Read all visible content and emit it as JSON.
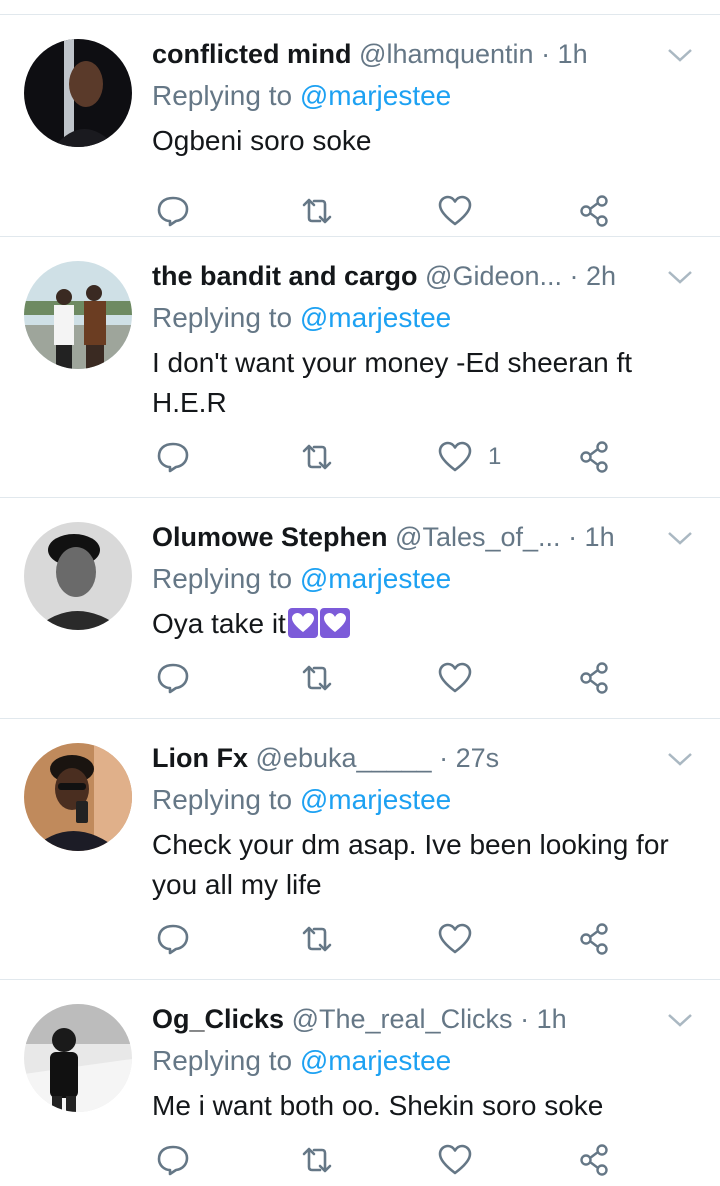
{
  "replying_label": "Replying to",
  "tweets": [
    {
      "name": "conflicted mind",
      "handle": "@lhamquentin",
      "time": "· 1h",
      "mention": "@marjestee",
      "text": "Ogbeni soro soke",
      "likes": ""
    },
    {
      "name": "the bandit and cargo",
      "handle": "@Gideon...",
      "time": "· 2h",
      "mention": "@marjestee",
      "text": "I don't want your money -Ed sheeran ft H.E.R",
      "likes": "1"
    },
    {
      "name": "Olumowe Stephen",
      "handle": "@Tales_of_...",
      "time": "· 1h",
      "mention": "@marjestee",
      "text": "Oya take it",
      "emoji": "purple-heart x2",
      "likes": ""
    },
    {
      "name": "Lion Fx",
      "handle": "@ebuka_____",
      "time": "· 27s",
      "mention": "@marjestee",
      "text": "Check your dm asap. Ive been looking for you all my life",
      "likes": ""
    },
    {
      "name": "Og_Clicks",
      "handle": "@The_real_Clicks",
      "time": "· 1h",
      "mention": "@marjestee",
      "text": "Me i want both oo. Shekin soro soke",
      "likes": ""
    }
  ],
  "colors": {
    "link": "#1da1f2",
    "secondary": "#657786",
    "divider": "#e1e8ed",
    "emoji_heart_bg": "#7c5bd9"
  },
  "icons": [
    "reply-icon",
    "retweet-icon",
    "like-icon",
    "share-icon",
    "chevron-down-icon"
  ]
}
